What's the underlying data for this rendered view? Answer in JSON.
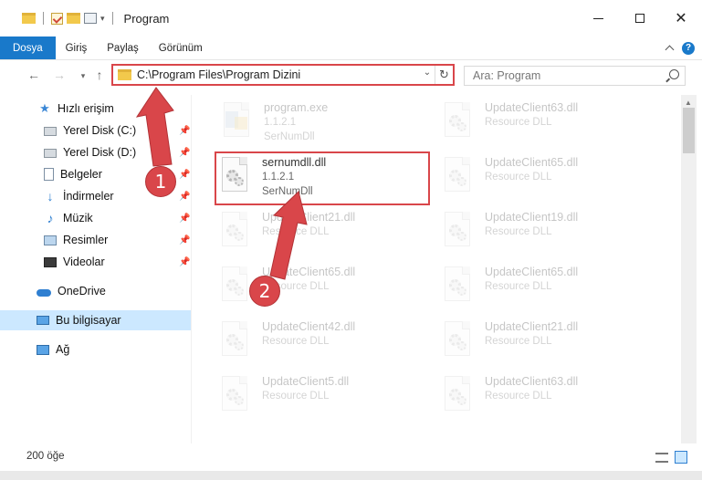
{
  "window": {
    "title": "Program",
    "minimize_icon": "minimize-icon",
    "maximize_icon": "maximize-icon",
    "close_label": "✕"
  },
  "ribbon": {
    "tabs": [
      "Dosya",
      "Giriş",
      "Paylaş",
      "Görünüm"
    ],
    "active_tab": "Dosya",
    "accent_color": "#1979ca"
  },
  "navigation": {
    "back": "←",
    "forward": "→",
    "recent": "▾",
    "up": "↑",
    "address": "C:\\Program Files\\Program Dizini",
    "address_dropdown": "⌄",
    "refresh": "↻",
    "search_placeholder": "Ara: Program"
  },
  "sidebar": {
    "items": [
      {
        "label": "Hızlı erişim",
        "icon": "star-icon",
        "pinned": false
      },
      {
        "label": "Yerel Disk (C:)",
        "icon": "disk-icon",
        "pinned": true
      },
      {
        "label": "Yerel Disk (D:)",
        "icon": "disk-icon",
        "pinned": true
      },
      {
        "label": "Belgeler",
        "icon": "documents-icon",
        "pinned": true
      },
      {
        "label": "İndirmeler",
        "icon": "downloads-icon",
        "pinned": true
      },
      {
        "label": "Müzik",
        "icon": "music-icon",
        "pinned": true
      },
      {
        "label": "Resimler",
        "icon": "pictures-icon",
        "pinned": true
      },
      {
        "label": "Videolar",
        "icon": "videos-icon",
        "pinned": true
      },
      {
        "label": "OneDrive",
        "icon": "onedrive-icon",
        "pinned": false
      },
      {
        "label": "Bu bilgisayar",
        "icon": "computer-icon",
        "pinned": false
      },
      {
        "label": "Ağ",
        "icon": "network-icon",
        "pinned": false
      }
    ],
    "selected": "Bu bilgisayar"
  },
  "files": {
    "left": [
      {
        "name": "program.exe",
        "sub1": "1.1.2.1",
        "sub2": "SerNumDll",
        "faded": true
      },
      {
        "name": "sernumdll.dll",
        "sub1": "1.1.2.1",
        "sub2": "SerNumDll",
        "faded": false
      },
      {
        "name": "UpdateClient21.dll",
        "sub1": "Resource DLL",
        "faded": true
      },
      {
        "name": "UpdateClient65.dll",
        "sub1": "Resource DLL",
        "faded": true
      },
      {
        "name": "UpdateClient42.dll",
        "sub1": "Resource DLL",
        "faded": true
      },
      {
        "name": "UpdateClient5.dll",
        "sub1": "Resource DLL",
        "faded": true
      }
    ],
    "right": [
      {
        "name": "UpdateClient63.dll",
        "sub1": "Resource DLL"
      },
      {
        "name": "UpdateClient65.dll",
        "sub1": "Resource DLL"
      },
      {
        "name": "UpdateClient19.dll",
        "sub1": "Resource DLL"
      },
      {
        "name": "UpdateClient65.dll",
        "sub1": "Resource DLL"
      },
      {
        "name": "UpdateClient21.dll",
        "sub1": "Resource DLL"
      },
      {
        "name": "UpdateClient63.dll",
        "sub1": "Resource DLL"
      }
    ]
  },
  "status": {
    "item_count": "200 öğe"
  },
  "annotations": {
    "step1": "1",
    "step2": "2",
    "color": "#d9464a"
  }
}
